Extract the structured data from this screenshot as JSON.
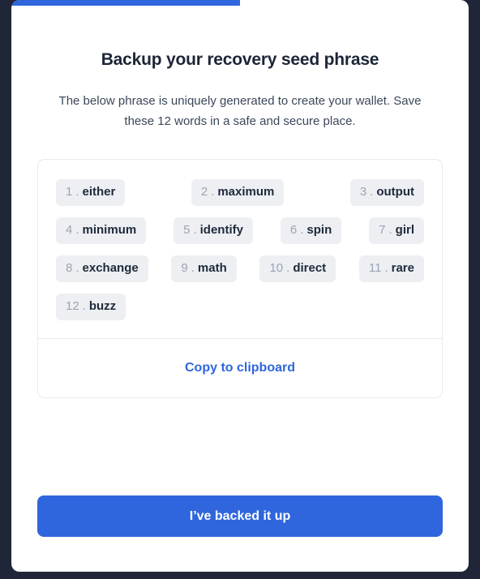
{
  "window": {
    "background_color": "#1f2637",
    "card_color": "#ffffff"
  },
  "progress": {
    "name": "onboarding-progress",
    "percent": 50,
    "color": "#2f66de"
  },
  "header": {
    "title": "Backup your recovery seed phrase",
    "subtitle": "The below phrase is uniquely generated to create your wallet. Save these 12 words in a safe and secure place."
  },
  "seed_phrase": {
    "chip_background": "#edeff2",
    "index_color": "#9aa4b4",
    "word_color": "#1e2a3b",
    "separator": ".",
    "rows": [
      [
        {
          "index": "1",
          "word": "either"
        },
        {
          "index": "2",
          "word": "maximum"
        },
        {
          "index": "3",
          "word": "output"
        }
      ],
      [
        {
          "index": "4",
          "word": "minimum"
        },
        {
          "index": "5",
          "word": "identify"
        },
        {
          "index": "6",
          "word": "spin"
        },
        {
          "index": "7",
          "word": "girl"
        }
      ],
      [
        {
          "index": "8",
          "word": "exchange"
        },
        {
          "index": "9",
          "word": "math"
        },
        {
          "index": "10",
          "word": "direct"
        },
        {
          "index": "11",
          "word": "rare"
        }
      ],
      [
        {
          "index": "12",
          "word": "buzz"
        }
      ]
    ]
  },
  "actions": {
    "copy_label": "Copy to clipboard",
    "copy_color": "#2f66de",
    "primary_label": "I’ve backed it up",
    "primary_color": "#2f66de"
  }
}
